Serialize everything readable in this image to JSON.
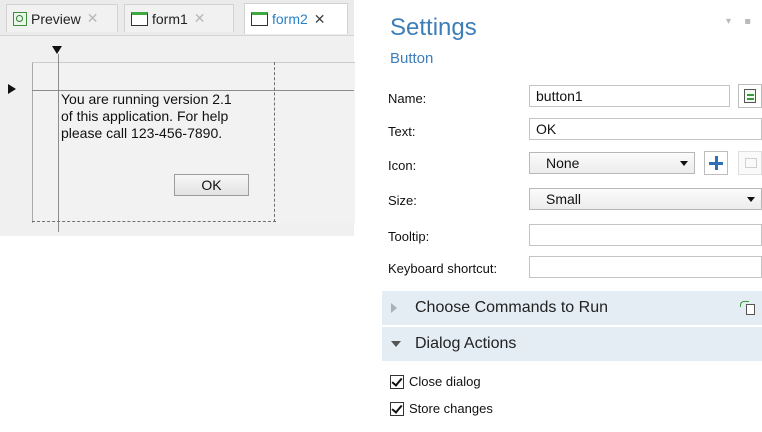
{
  "tabs": [
    {
      "label": "Preview",
      "icon": "preview-icon",
      "active": false
    },
    {
      "label": "form1",
      "icon": "form-icon",
      "active": false
    },
    {
      "label": "form2",
      "icon": "form-icon",
      "active": true
    }
  ],
  "close_glyph": "✕",
  "form_preview": {
    "message_lines": [
      "You are running version 2.1",
      "of this application. For help",
      "please call 123-456-7890."
    ],
    "button_label": "OK"
  },
  "settings": {
    "title": "Settings",
    "subtitle": "Button",
    "fields": {
      "name_label": "Name:",
      "name_value": "button1",
      "text_label": "Text:",
      "text_value": "OK",
      "icon_label": "Icon:",
      "icon_value": "None",
      "size_label": "Size:",
      "size_value": "Small",
      "tooltip_label": "Tooltip:",
      "tooltip_value": "",
      "shortcut_label": "Keyboard shortcut:",
      "shortcut_value": ""
    },
    "sections": [
      {
        "label": "Choose Commands to Run",
        "expanded": false
      },
      {
        "label": "Dialog Actions",
        "expanded": true
      }
    ],
    "dialog_actions": [
      {
        "label": "Close dialog",
        "checked": true
      },
      {
        "label": "Store changes",
        "checked": true
      }
    ]
  },
  "colors": {
    "accent": "#3d7eb8",
    "active_tab_text": "#2a82c8",
    "section_bg": "#e4ecf4"
  }
}
